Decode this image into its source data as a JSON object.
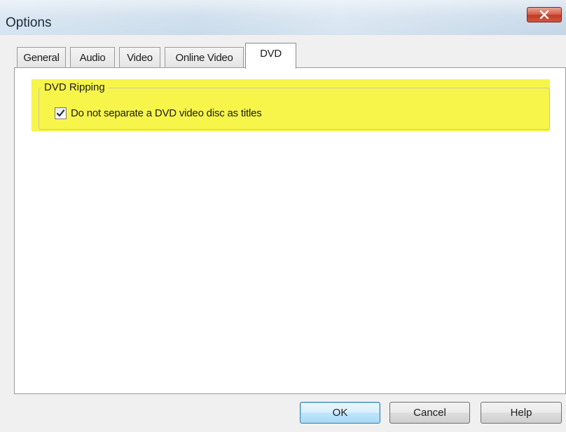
{
  "window": {
    "title": "Options",
    "close_icon": "close-icon"
  },
  "tabs": [
    {
      "label": "General",
      "active": false
    },
    {
      "label": "Audio",
      "active": false
    },
    {
      "label": "Video",
      "active": false
    },
    {
      "label": "Online Video",
      "active": false
    },
    {
      "label": "DVD",
      "active": true
    }
  ],
  "dvd_panel": {
    "group_label": "DVD Ripping",
    "checkbox": {
      "label": "Do not separate a DVD video disc as titles",
      "checked": true
    }
  },
  "buttons": {
    "ok_label": "OK",
    "cancel_label": "Cancel",
    "help_label": "Help"
  },
  "colors": {
    "highlight": "#f7f54a",
    "close_button": "#c13b26",
    "default_button_border": "#3c7fb1"
  }
}
